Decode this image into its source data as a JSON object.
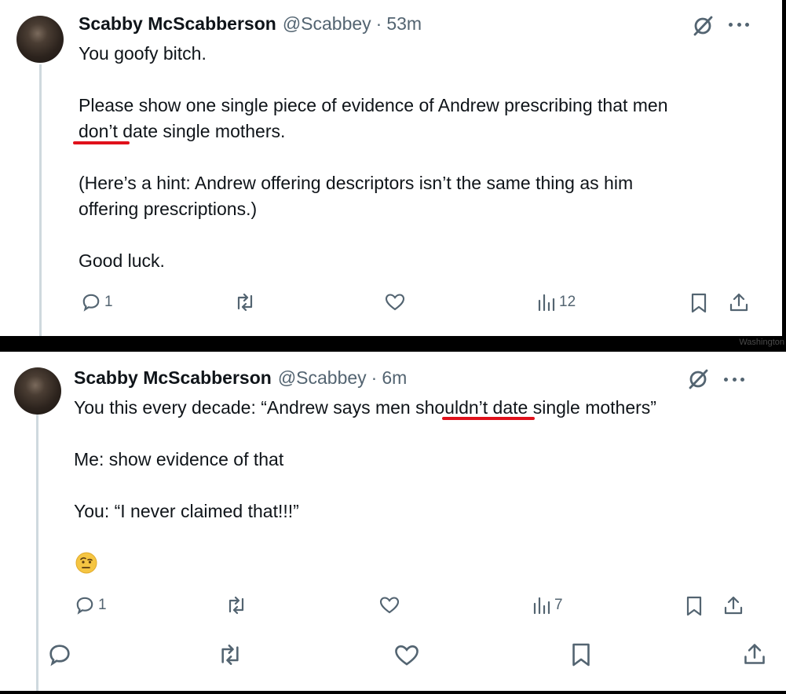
{
  "tweet1": {
    "name": "Scabby McScabberson",
    "handle": "@Scabbey",
    "separator": "·",
    "time": "53m",
    "line1": "You goofy bitch.",
    "line2": "Please show one single piece of evidence of Andrew prescribing that men",
    "line3": "don’t date single mothers.",
    "line4": "(Here’s a hint: Andrew offering descriptors isn’t the same thing as him",
    "line5": "offering prescriptions.)",
    "line6": "Good luck.",
    "replies": "1",
    "views": "12"
  },
  "strip": {
    "partial_text": "Washington"
  },
  "tweet2": {
    "name": "Scabby McScabberson",
    "handle": "@Scabbey",
    "separator": "·",
    "time": "6m",
    "line1": "You this every decade: “Andrew says men shouldn’t date single mothers”",
    "line2": "Me: show evidence of that",
    "line3": "You: “I never claimed that!!!”",
    "emoji": "face-with-raised-eyebrow",
    "replies": "1",
    "views": "7"
  },
  "colors": {
    "text": "#0f1419",
    "secondary": "#536471",
    "thread_line": "#cfd9de",
    "red_underline": "#e0111b"
  }
}
